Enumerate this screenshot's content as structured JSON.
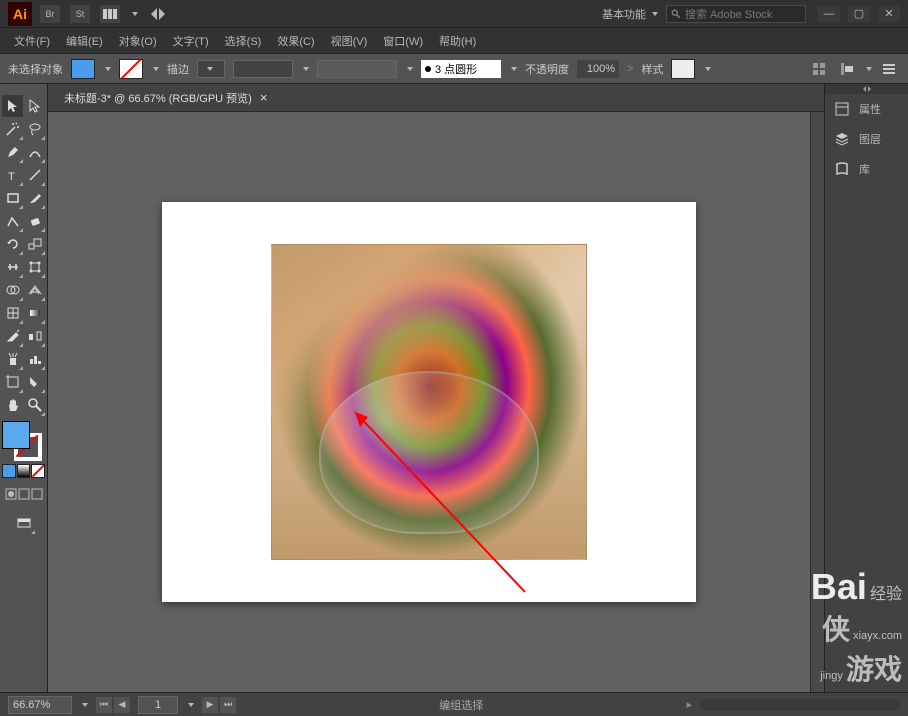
{
  "app_name": "Ai",
  "titlebar": {
    "workspace": "基本功能",
    "search_placeholder": "搜索 Adobe Stock"
  },
  "menus": [
    {
      "label": "文件(F)"
    },
    {
      "label": "编辑(E)"
    },
    {
      "label": "对象(O)"
    },
    {
      "label": "文字(T)"
    },
    {
      "label": "选择(S)"
    },
    {
      "label": "效果(C)"
    },
    {
      "label": "视图(V)"
    },
    {
      "label": "窗口(W)"
    },
    {
      "label": "帮助(H)"
    }
  ],
  "control_bar": {
    "selection": "未选择对象",
    "stroke_label": "描边",
    "profile_label": "3 点圆形",
    "opacity_label": "不透明度",
    "opacity_value": "100%",
    "style_label": "样式"
  },
  "document": {
    "tab_title": "未标题-3* @ 66.67% (RGB/GPU 预览)"
  },
  "panels": {
    "properties": "属性",
    "layers": "图层",
    "libraries": "库"
  },
  "statusbar": {
    "zoom": "66.67%",
    "artboard_nav": "1",
    "mode": "编组选择"
  },
  "watermark": {
    "brand": "Bai",
    "label": "经验",
    "site1": "xiayx.com",
    "site2": "jingy",
    "cn": "侠",
    "game": "游戏"
  },
  "colors": {
    "fill": "#5aa9ec",
    "stroke": "none"
  }
}
